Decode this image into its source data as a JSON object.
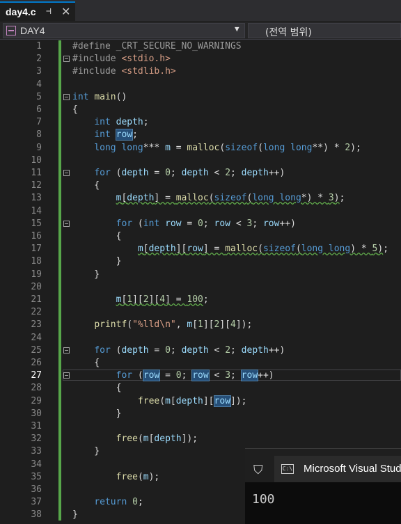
{
  "tab": {
    "title": "day4.c",
    "pin_glyph": "⊣",
    "close_glyph": "✕"
  },
  "navbar": {
    "project": "DAY4",
    "scope": "(전역 범위)"
  },
  "editor": {
    "active_line": 27,
    "lines": [
      {
        "n": "1",
        "html": "<span class=\"pp\">#define _CRT_SECURE_NO_WARNINGS</span>"
      },
      {
        "n": "2",
        "html": "<span class=\"pp\">#include </span><span class=\"str\">&lt;stdio.h&gt;</span>"
      },
      {
        "n": "3",
        "html": "<span class=\"pp\">#include </span><span class=\"str\">&lt;stdlib.h&gt;</span>"
      },
      {
        "n": "4",
        "html": ""
      },
      {
        "n": "5",
        "html": "<span class=\"kw\">int</span> <span class=\"fn\">main</span>()"
      },
      {
        "n": "6",
        "html": "{"
      },
      {
        "n": "7",
        "html": "    <span class=\"kw\">int</span> <span class=\"var\">depth</span>;"
      },
      {
        "n": "8",
        "html": "    <span class=\"kw\">int</span> <span class=\"var hl\">row</span>;"
      },
      {
        "n": "9",
        "html": "    <span class=\"kw\">long long</span>*** <span class=\"var\">m</span> = <span class=\"fn\">malloc</span>(<span class=\"kw\">sizeof</span>(<span class=\"kw\">long long</span>**) * <span class=\"num\">2</span>);"
      },
      {
        "n": "10",
        "html": ""
      },
      {
        "n": "11",
        "html": "    <span class=\"kw\">for</span> (<span class=\"var\">depth</span> = <span class=\"num\">0</span>; <span class=\"var\">depth</span> &lt; <span class=\"num\">2</span>; <span class=\"var\">depth</span>++)"
      },
      {
        "n": "12",
        "html": "    {"
      },
      {
        "n": "13",
        "html": "        <span class=\"sq\"><span class=\"var\">m</span>[<span class=\"var\">depth</span>] = <span class=\"fn\">malloc</span>(<span class=\"kw\">sizeof</span>(<span class=\"kw\">long long</span>*) * <span class=\"num\">3</span>)</span>;"
      },
      {
        "n": "14",
        "html": ""
      },
      {
        "n": "15",
        "html": "        <span class=\"kw\">for</span> (<span class=\"kw\">int</span> <span class=\"var\">row</span> = <span class=\"num\">0</span>; <span class=\"var\">row</span> &lt; <span class=\"num\">3</span>; <span class=\"var\">row</span>++)"
      },
      {
        "n": "16",
        "html": "        {"
      },
      {
        "n": "17",
        "html": "            <span class=\"sq\"><span class=\"var\">m</span>[<span class=\"var\">depth</span>][<span class=\"var\">row</span>] = <span class=\"fn\">malloc</span>(<span class=\"kw\">sizeof</span>(<span class=\"kw\">long long</span>) * <span class=\"num\">5</span>)</span>;"
      },
      {
        "n": "18",
        "html": "        }"
      },
      {
        "n": "19",
        "html": "    }"
      },
      {
        "n": "20",
        "html": ""
      },
      {
        "n": "21",
        "html": "        <span class=\"sq\"><span class=\"var\">m</span>[<span class=\"num\">1</span>][<span class=\"num\">2</span>][<span class=\"num\">4</span>] = <span class=\"num\">100</span></span>;"
      },
      {
        "n": "22",
        "html": ""
      },
      {
        "n": "23",
        "html": "    <span class=\"fn\">printf</span>(<span class=\"str\">\"%lld\\n\"</span>, <span class=\"var\">m</span>[<span class=\"num\">1</span>][<span class=\"num\">2</span>][<span class=\"num\">4</span>]);"
      },
      {
        "n": "24",
        "html": ""
      },
      {
        "n": "25",
        "html": "    <span class=\"kw\">for</span> (<span class=\"var\">depth</span> = <span class=\"num\">0</span>; <span class=\"var\">depth</span> &lt; <span class=\"num\">2</span>; <span class=\"var\">depth</span>++)"
      },
      {
        "n": "26",
        "html": "    {"
      },
      {
        "n": "27",
        "html": "        <span class=\"kw\">for</span> (<span class=\"var hl\">row</span> = <span class=\"num\">0</span>; <span class=\"var hl\">row</span> &lt; <span class=\"num\">3</span>; <span class=\"var hl\">row</span>++)"
      },
      {
        "n": "28",
        "html": "        {"
      },
      {
        "n": "29",
        "html": "            <span class=\"fn\">free</span>(<span class=\"var\">m</span>[<span class=\"var\">depth</span>][<span class=\"var hl\">row</span>]);"
      },
      {
        "n": "30",
        "html": "        }"
      },
      {
        "n": "31",
        "html": ""
      },
      {
        "n": "32",
        "html": "        <span class=\"fn\">free</span>(<span class=\"var\">m</span>[<span class=\"var\">depth</span>]);"
      },
      {
        "n": "33",
        "html": "    }"
      },
      {
        "n": "34",
        "html": ""
      },
      {
        "n": "35",
        "html": "        <span class=\"fn\">free</span>(<span class=\"var\">m</span>);"
      },
      {
        "n": "36",
        "html": ""
      },
      {
        "n": "37",
        "html": "    <span class=\"kw\">return</span> <span class=\"num\">0</span>;"
      },
      {
        "n": "38",
        "html": "}"
      }
    ],
    "fold_lines": [
      2,
      5,
      11,
      15,
      25,
      27
    ]
  },
  "console": {
    "title": "Microsoft Visual Studio",
    "icon_text": "C:\\",
    "output": "100"
  }
}
